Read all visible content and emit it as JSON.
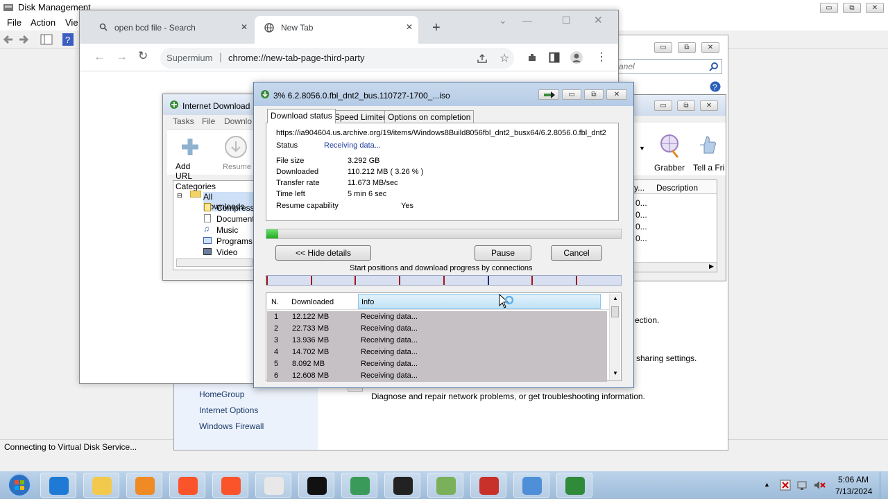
{
  "disk_mgmt": {
    "title": "Disk Management",
    "menu": [
      "File",
      "Action",
      "Vie"
    ],
    "status": "Connecting to Virtual Disk Service...",
    "btn_min": "▭",
    "btn_max": "⧉",
    "btn_close": "✕"
  },
  "control_panel": {
    "search_placeholder": "anel",
    "links": [
      "HomeGroup",
      "Internet Options",
      "Windows Firewall"
    ],
    "text_connection": "ection.",
    "text_sharing": "sharing settings.",
    "text_diagnose": "Diagnose and repair network problems, or get troubleshooting information."
  },
  "chrome": {
    "tab1": "open bcd file - Search",
    "tab2": "New Tab",
    "omni_site": "Supermium",
    "omni_url": "chrome://new-tab-page-third-party"
  },
  "idm": {
    "title": "Internet Download",
    "menu": [
      "Tasks",
      "File",
      "Downlo"
    ],
    "add_url": "Add URL",
    "resume": "Resume",
    "categories": "Categories",
    "tree": [
      "All Downloads",
      "Compresse",
      "Documents",
      "Music",
      "Programs",
      "Video"
    ],
    "grabber": "Grabber",
    "tell": "Tell a Fri",
    "col_by": "y...",
    "col_desc": "Description",
    "cells": [
      "0...",
      "0...",
      "0...",
      "0..."
    ]
  },
  "dlg": {
    "title": "3% 6.2.8056.0.fbl_dnt2_bus.110727-1700_...iso",
    "tabs": [
      "Download status",
      "Speed Limiter",
      "Options on completion"
    ],
    "url": "https://ia904604.us.archive.org/19/items/Windows8Build8056fbl_dnt2_busx64/6.2.8056.0.fbl_dnt2",
    "status_label": "Status",
    "status_value": "Receiving data...",
    "file_size_label": "File size",
    "file_size": "3.292  GB",
    "downloaded_label": "Downloaded",
    "downloaded": "110.212  MB  ( 3.26 % )",
    "rate_label": "Transfer rate",
    "rate": "11.673  MB/sec",
    "time_label": "Time left",
    "time": "5 min 6 sec",
    "resume_label": "Resume capability",
    "resume": "Yes",
    "progress": 0.0326,
    "hide_details": "<< Hide details",
    "pause": "Pause",
    "cancel": "Cancel",
    "conn_caption": "Start positions and download progress by connections",
    "col_n": "N.",
    "col_downloaded": "Downloaded",
    "col_info": "Info",
    "rows": [
      {
        "n": "1",
        "dl": "12.122  MB",
        "info": "Receiving data..."
      },
      {
        "n": "2",
        "dl": "22.733  MB",
        "info": "Receiving data..."
      },
      {
        "n": "3",
        "dl": "13.936  MB",
        "info": "Receiving data..."
      },
      {
        "n": "4",
        "dl": "14.702  MB",
        "info": "Receiving data..."
      },
      {
        "n": "5",
        "dl": "8.092  MB",
        "info": "Receiving data..."
      },
      {
        "n": "6",
        "dl": "12.608  MB",
        "info": "Receiving data..."
      }
    ]
  },
  "taskbar": {
    "time": "5:06 AM",
    "date": "7/13/2024",
    "apps": [
      "ie-icon",
      "explorer-icon",
      "media-icon",
      "brave-icon",
      "brave-icon",
      "solitaire-icon",
      "cmd-icon",
      "globe-icon",
      "7zip-icon",
      "scanner-icon",
      "toolbox-icon",
      "control-panel-icon",
      "idm-icon"
    ]
  },
  "colors": {
    "progress": "#2ecc40",
    "accent": "#2f6fc5"
  }
}
